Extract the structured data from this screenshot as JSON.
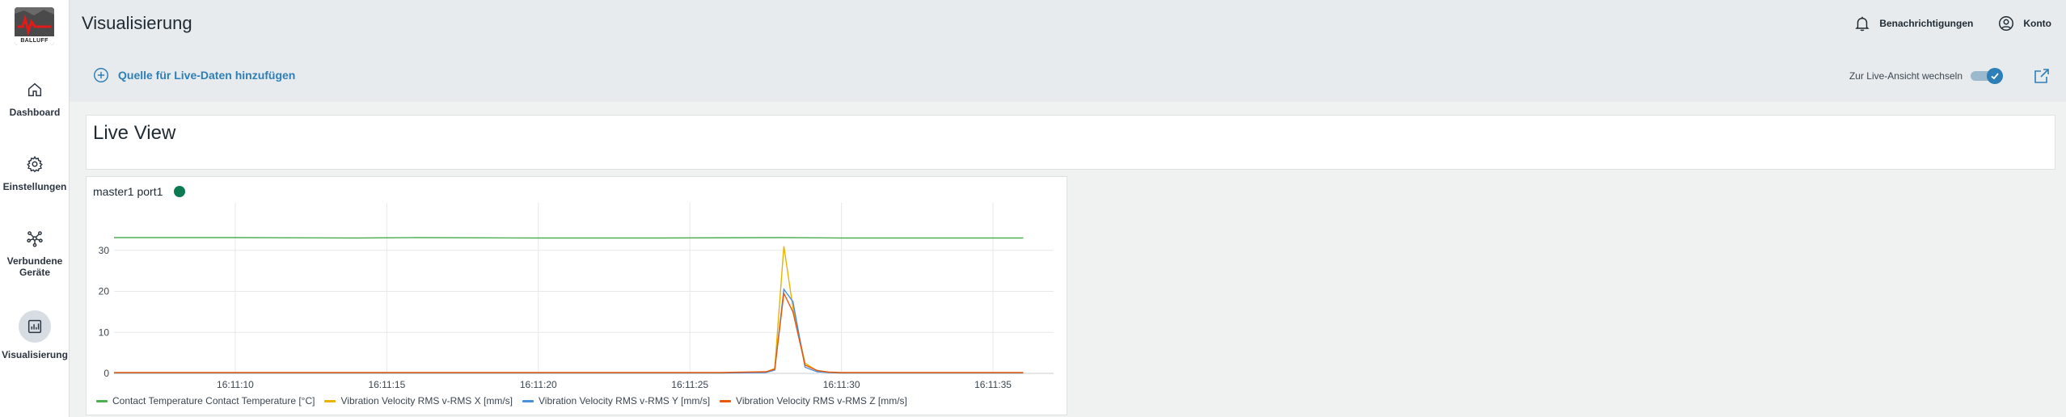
{
  "app": {
    "logo_text": "BALLUFF"
  },
  "sidebar": {
    "items": [
      {
        "label": "Dashboard",
        "icon": "home-icon",
        "active": false
      },
      {
        "label": "Einstellungen",
        "icon": "gear-icon",
        "active": false
      },
      {
        "label": "Verbundene Geräte",
        "label_line1": "Verbundene",
        "label_line2": "Geräte",
        "icon": "network-icon",
        "active": false
      },
      {
        "label": "Visualisierung",
        "icon": "chart-icon",
        "active": true
      }
    ]
  },
  "header": {
    "title": "Visualisierung",
    "notifications_label": "Benachrichtigungen",
    "account_label": "Konto",
    "add_source_label": "Quelle für Live-Daten hinzufügen",
    "live_toggle_label": "Zur Live-Ansicht wechseln",
    "live_toggle_on": true
  },
  "main": {
    "panel_title": "Live View",
    "card": {
      "source_name": "master1 port1",
      "status_color": "#0b7a52"
    }
  },
  "colors": {
    "accent": "#2e7fb8",
    "series_green": "#4caf50",
    "series_yellow": "#e8b400",
    "series_blue": "#4a90d9",
    "series_orange": "#e8580c"
  },
  "chart_data": {
    "type": "line",
    "title": "",
    "xlabel": "",
    "ylabel": "",
    "ylim": [
      0,
      40
    ],
    "yticks": [
      0,
      10,
      20,
      30
    ],
    "xlim_seconds": [
      6.0,
      37.0
    ],
    "xticks": [
      "16:11:10",
      "16:11:15",
      "16:11:20",
      "16:11:25",
      "16:11:30",
      "16:11:35"
    ],
    "xtick_seconds": [
      10,
      15,
      20,
      25,
      30,
      35
    ],
    "grid": true,
    "legend_position": "bottom",
    "series": [
      {
        "name": "Contact Temperature Contact Temperature [°C]",
        "color": "#4caf50",
        "x": [
          6,
          10,
          14,
          16,
          20,
          24,
          28,
          30,
          34,
          36
        ],
        "y": [
          33.1,
          33.1,
          33.0,
          33.1,
          33.0,
          33.0,
          33.1,
          33.0,
          33.0,
          33.0
        ]
      },
      {
        "name": "Vibration Velocity RMS v-RMS X [mm/s]",
        "color": "#e8b400",
        "x": [
          6,
          26,
          27.5,
          27.8,
          28.1,
          28.4,
          28.8,
          29.2,
          29.6,
          30,
          36
        ],
        "y": [
          0.1,
          0.1,
          0.3,
          1.2,
          31.0,
          16.0,
          2.5,
          0.6,
          0.2,
          0.1,
          0.1
        ]
      },
      {
        "name": "Vibration Velocity RMS v-RMS Y [mm/s]",
        "color": "#4a90d9",
        "x": [
          6,
          26,
          27.5,
          27.8,
          28.1,
          28.4,
          28.8,
          29.2,
          29.6,
          30,
          36
        ],
        "y": [
          0.1,
          0.1,
          0.2,
          0.8,
          20.5,
          17.5,
          1.5,
          0.4,
          0.2,
          0.1,
          0.1
        ]
      },
      {
        "name": "Vibration Velocity RMS v-RMS Z [mm/s]",
        "color": "#e8580c",
        "x": [
          6,
          26,
          27.5,
          27.8,
          28.1,
          28.4,
          28.8,
          29.2,
          29.6,
          30,
          36
        ],
        "y": [
          0.2,
          0.2,
          0.4,
          1.0,
          19.5,
          15.0,
          2.0,
          0.7,
          0.3,
          0.2,
          0.2
        ]
      }
    ]
  }
}
